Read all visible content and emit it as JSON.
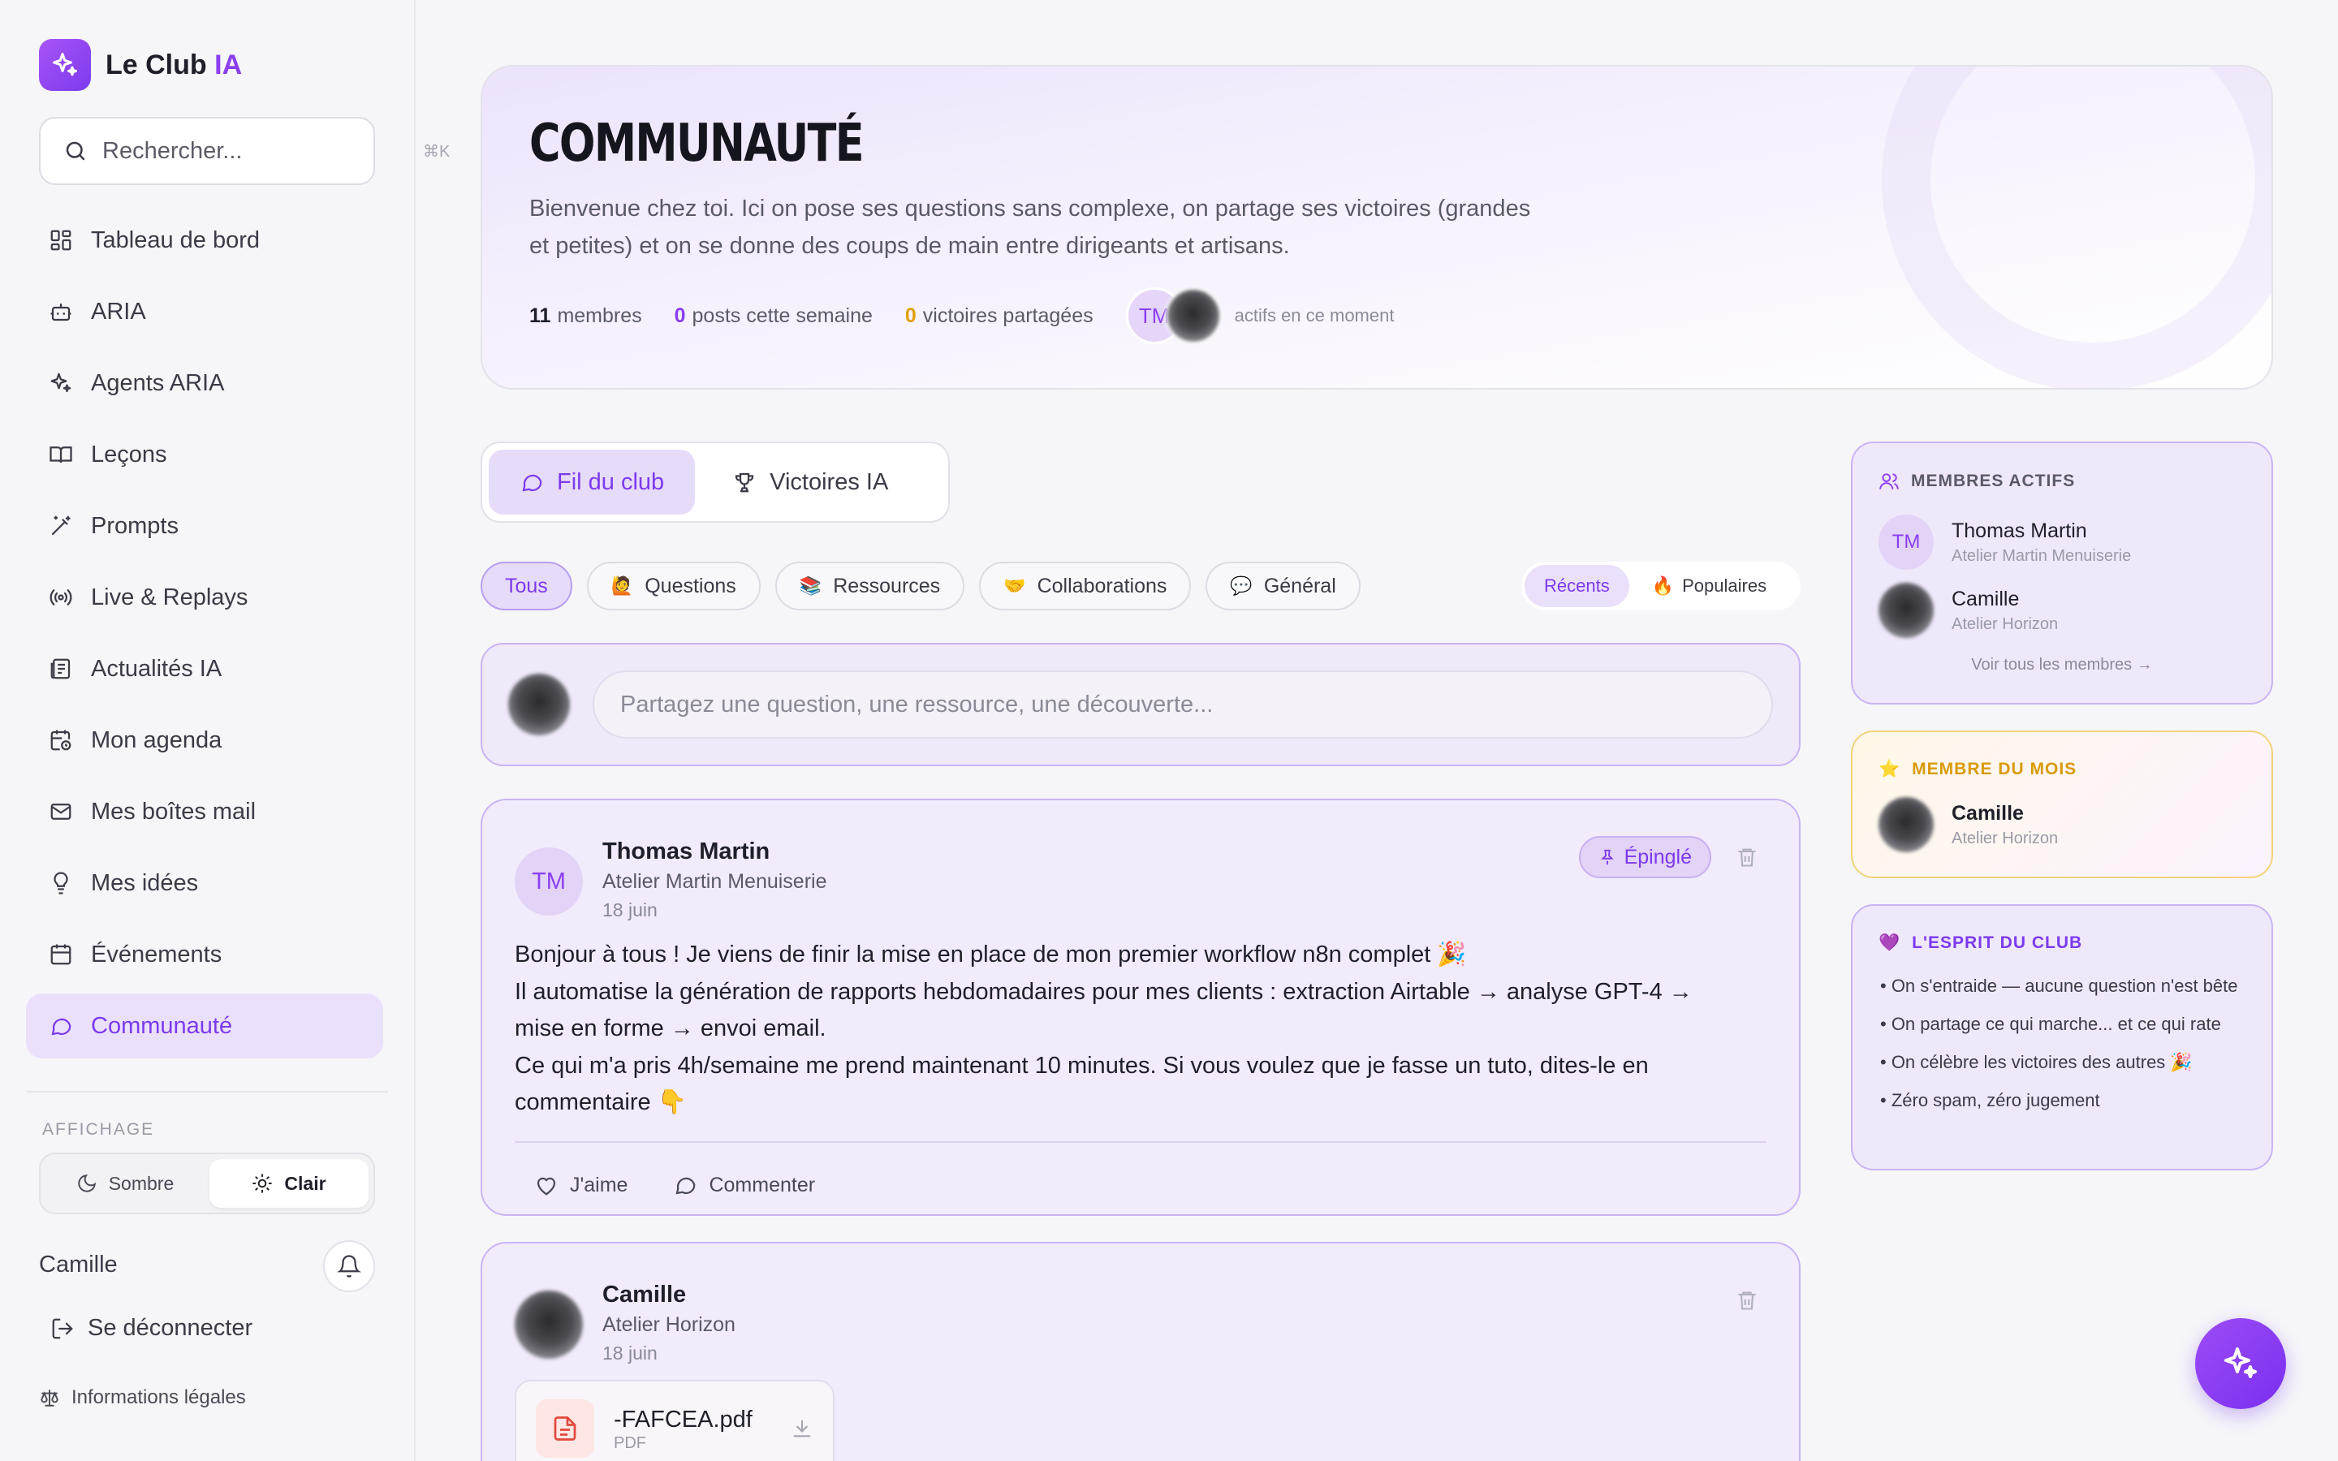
{
  "brand": {
    "name": "Le Club",
    "accent": "IA"
  },
  "search": {
    "placeholder": "Rechercher...",
    "shortcut": "⌘K"
  },
  "nav": [
    {
      "label": "Tableau de bord",
      "icon": "dashboard-icon"
    },
    {
      "label": "ARIA",
      "icon": "bot-icon"
    },
    {
      "label": "Agents ARIA",
      "icon": "sparkles-icon"
    },
    {
      "label": "Leçons",
      "icon": "book-icon"
    },
    {
      "label": "Prompts",
      "icon": "magic-wand-icon"
    },
    {
      "label": "Live & Replays",
      "icon": "broadcast-icon"
    },
    {
      "label": "Actualités IA",
      "icon": "newspaper-icon"
    },
    {
      "label": "Mon agenda",
      "icon": "calendar-clock-icon"
    },
    {
      "label": "Mes boîtes mail",
      "icon": "mail-icon"
    },
    {
      "label": "Mes idées",
      "icon": "lightbulb-icon"
    },
    {
      "label": "Événements",
      "icon": "calendar-icon"
    },
    {
      "label": "Communauté",
      "icon": "chat-bubble-icon",
      "active": true
    }
  ],
  "display": {
    "label": "AFFICHAGE",
    "dark": "Sombre",
    "light": "Clair",
    "selected": "Clair"
  },
  "user": {
    "name": "Camille",
    "logout": "Se déconnecter",
    "legal": "Informations légales"
  },
  "hero": {
    "title": "COMMUNAUTÉ",
    "description": "Bienvenue chez toi. Ici on pose ses questions sans complexe, on partage ses victoires (grandes et petites) et on se donne des coups de main entre dirigeants et artisans.",
    "members_count": "11",
    "members_label": "membres",
    "posts_count": "0",
    "posts_label": "posts cette semaine",
    "wins_count": "0",
    "wins_label": "victoires partagées",
    "avatar_initials": "TM",
    "active_label": "actifs en ce moment"
  },
  "tabs": [
    {
      "label": "Fil du club",
      "active": true
    },
    {
      "label": "Victoires IA",
      "active": false
    }
  ],
  "filters": [
    {
      "label": "Tous",
      "emoji": "",
      "active": true
    },
    {
      "label": "Questions",
      "emoji": "🙋",
      "active": false
    },
    {
      "label": "Ressources",
      "emoji": "📚",
      "active": false
    },
    {
      "label": "Collaborations",
      "emoji": "🤝",
      "active": false
    },
    {
      "label": "Général",
      "emoji": "💬",
      "active": false
    }
  ],
  "sort": {
    "recent": "Récents",
    "popular": "Populaires",
    "popular_emoji": "🔥"
  },
  "composer": {
    "placeholder": "Partagez une question, une ressource, une découverte..."
  },
  "posts": [
    {
      "initials": "TM",
      "author": "Thomas Martin",
      "org": "Atelier Martin Menuiserie",
      "date": "18 juin",
      "pinned": "Épinglé",
      "body": "Bonjour à tous ! Je viens de finir la mise en place de mon premier workflow n8n complet 🎉\nIl automatise la génération de rapports hebdomadaires pour mes clients : extraction Airtable → analyse GPT-4 → mise en forme → envoi email.\nCe qui m'a pris 4h/semaine me prend maintenant 10 minutes. Si vous voulez que je fasse un tuto, dites-le en commentaire 👇",
      "like": "J'aime",
      "comment": "Commenter"
    },
    {
      "author": "Camille",
      "org": "Atelier Horizon",
      "date": "18 juin",
      "attachment": {
        "name": "-FAFCEA.pdf",
        "type": "PDF"
      }
    }
  ],
  "members_card": {
    "title": "MEMBRES ACTIFS",
    "members": [
      {
        "initials": "TM",
        "name": "Thomas Martin",
        "org": "Atelier Martin Menuiserie"
      },
      {
        "name": "Camille",
        "org": "Atelier Horizon"
      }
    ],
    "see_all": "Voir tous les membres →"
  },
  "month_card": {
    "title": "MEMBRE DU MOIS",
    "emoji": "⭐",
    "name": "Camille",
    "org": "Atelier Horizon"
  },
  "spirit_card": {
    "title": "L'ESPRIT DU CLUB",
    "emoji": "💜",
    "items": [
      "• On s'entraide — aucune question n'est bête",
      "• On partage ce qui marche... et ce qui rate",
      "• On célèbre les victoires des autres 🎉",
      "• Zéro spam, zéro jugement"
    ]
  },
  "colors": {
    "accent": "#8b3ff0",
    "gold": "#e0a008",
    "background": "#f6f6f9"
  }
}
